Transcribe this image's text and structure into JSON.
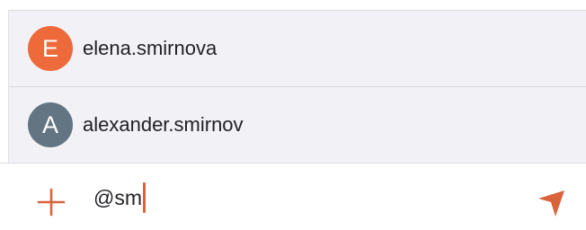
{
  "suggestions": [
    {
      "initial": "E",
      "username": "elena.smirnova",
      "avatar_color": "#ee6a3a"
    },
    {
      "initial": "A",
      "username": "alexander.smirnov",
      "avatar_color": "#637482"
    }
  ],
  "composer": {
    "input_value": "@sm",
    "add_icon": "plus-icon",
    "send_icon": "send-icon",
    "accent_color": "#d9633a"
  }
}
